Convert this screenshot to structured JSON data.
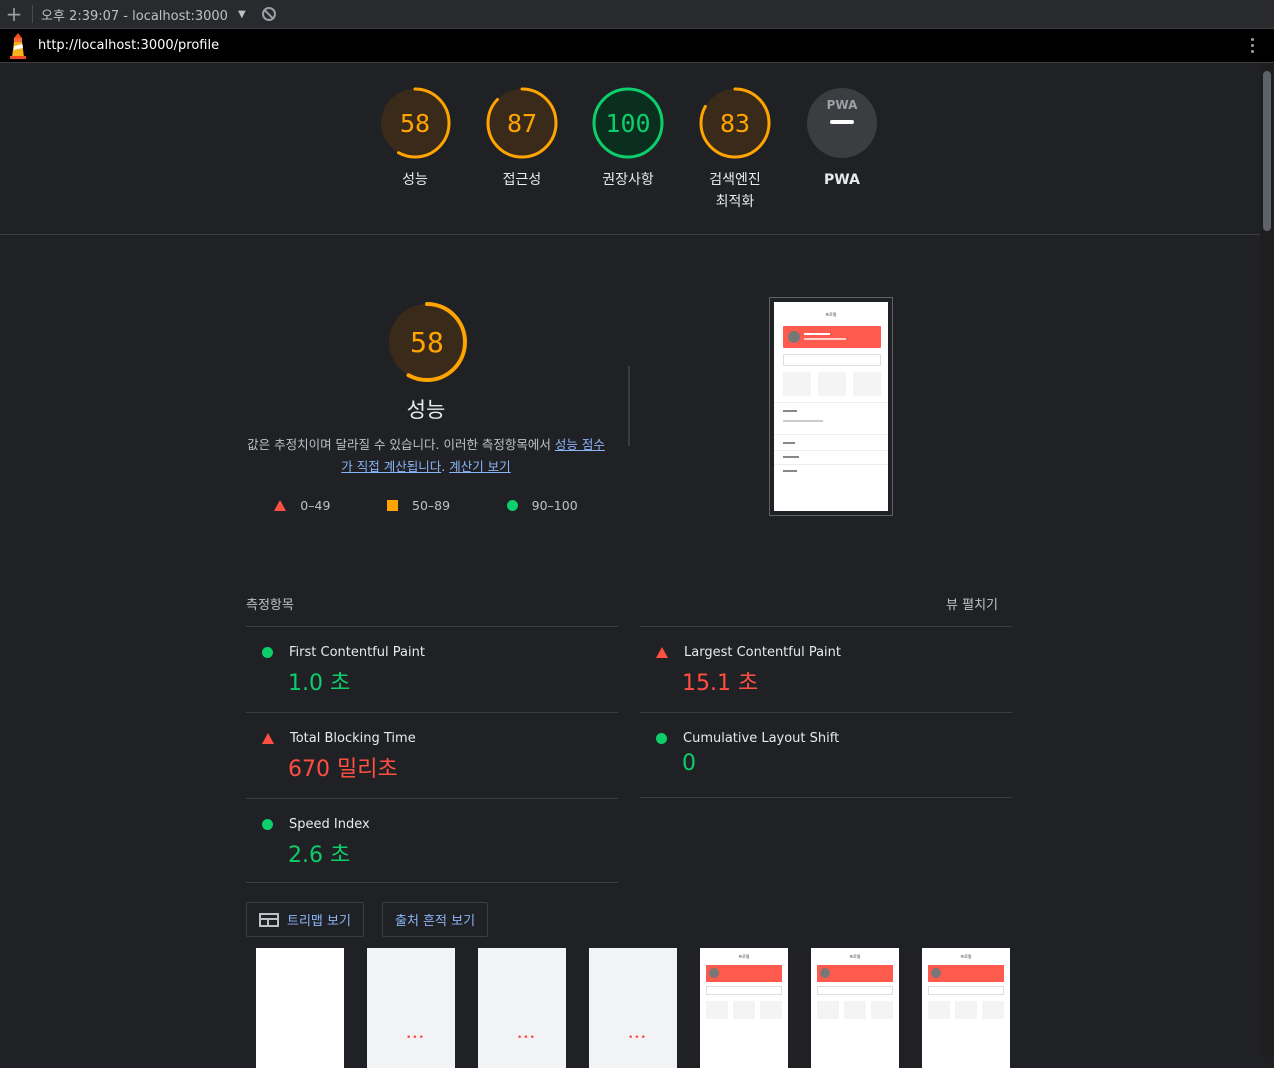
{
  "browser": {
    "session_label": "오후 2:39:07 - localhost:3000",
    "url": "http://localhost:3000/profile"
  },
  "summary": {
    "gauges": [
      {
        "score": "58",
        "label": "성능",
        "value": 58,
        "color": "#ffa400"
      },
      {
        "score": "87",
        "label": "접근성",
        "value": 87,
        "color": "#ffa400"
      },
      {
        "score": "100",
        "label": "권장사항",
        "value": 100,
        "color": "#0cce6b"
      },
      {
        "score": "83",
        "label": "검색엔진 최적화",
        "value": 83,
        "color": "#ffa400"
      },
      {
        "score": "",
        "label": "PWA",
        "badge": "PWA"
      }
    ]
  },
  "performance": {
    "score": "58",
    "value": 58,
    "title": "성능",
    "desc_text": "값은 추정치이며 달라질 수 있습니다. 이러한 측정항목에서 ",
    "desc_link1": "성능 점수가 직접 계산됩니다",
    "desc_mid": ". ",
    "desc_link2": "계산기 보기",
    "legend": [
      "0–49",
      "50–89",
      "90–100"
    ]
  },
  "screenshot_preview": {
    "title": "프로필"
  },
  "metrics": {
    "heading": "측정항목",
    "expand_label": "뷰 펼치기",
    "items": [
      {
        "name": "First Contentful Paint",
        "value": "1.0 초",
        "status": "pass"
      },
      {
        "name": "Largest Contentful Paint",
        "value": "15.1 초",
        "status": "fail"
      },
      {
        "name": "Total Blocking Time",
        "value": "670 밀리초",
        "status": "fail"
      },
      {
        "name": "Cumulative Layout Shift",
        "value": "0",
        "status": "pass"
      },
      {
        "name": "Speed Index",
        "value": "2.6 초",
        "status": "pass"
      }
    ]
  },
  "buttons": {
    "treemap": "트리맵 보기",
    "trace": "출처 흔적 보기"
  },
  "filmstrip": {
    "frame_title": "프로필",
    "frames": [
      "blank",
      "loading",
      "loading",
      "loading",
      "page",
      "page",
      "page"
    ]
  },
  "colors": {
    "pass": "#0cce6b",
    "average": "#ffa400",
    "fail": "#ff4e42"
  }
}
